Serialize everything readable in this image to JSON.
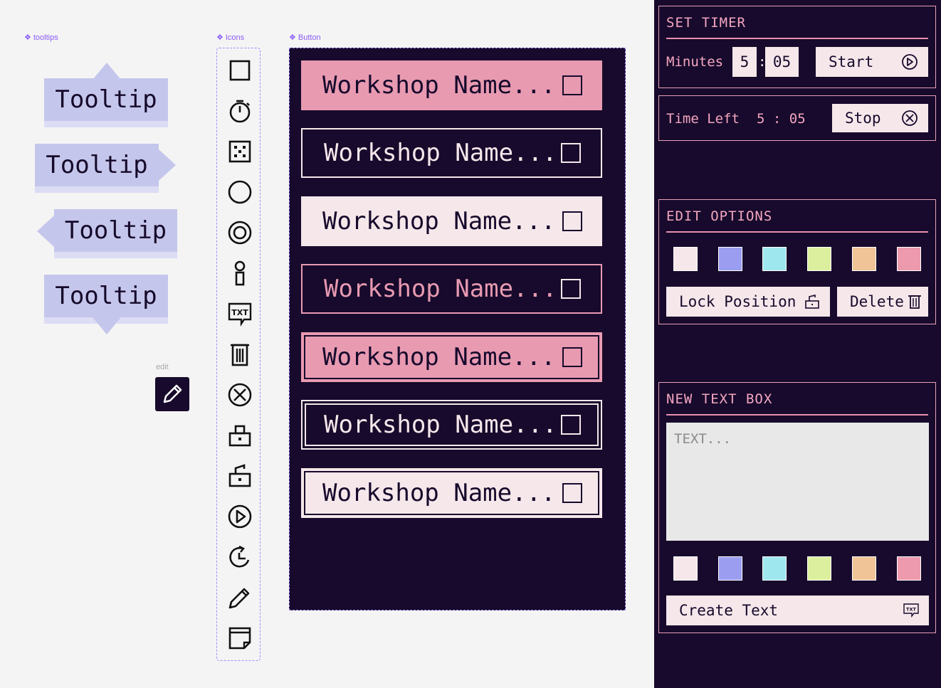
{
  "frames": {
    "tooltips_label": "tooltips",
    "icons_label": "Icons",
    "button_label": "Button",
    "edit_label": "edit"
  },
  "tooltips": [
    "Tooltip",
    "Tooltip",
    "Tooltip",
    "Tooltip"
  ],
  "icons": [
    "square-icon",
    "timer-icon",
    "dice-icon",
    "circle-icon",
    "target-icon",
    "person-icon",
    "txt-icon",
    "trash-icon",
    "close-circle-icon",
    "lock-icon",
    "unlock-icon",
    "play-icon",
    "restart-icon",
    "pencil-icon",
    "note-icon"
  ],
  "workshop_buttons": [
    "Workshop Name...",
    "Workshop Name...",
    "Workshop Name...",
    "Workshop Name...",
    "Workshop Name...",
    "Workshop Name...",
    "Workshop Name..."
  ],
  "set_timer": {
    "title": "SET TIMER",
    "minutes_label": "Minutes",
    "minutes_value": "5",
    "colon": ":",
    "seconds_value": "05",
    "start_label": "Start"
  },
  "time_left": {
    "label": "Time Left",
    "value": "5 : 05",
    "stop_label": "Stop"
  },
  "edit_options": {
    "title": "EDIT OPTIONS",
    "lock_label": "Lock Position",
    "delete_label": "Delete"
  },
  "new_text_box": {
    "title": "NEW TEXT BOX",
    "placeholder": "TEXT...",
    "create_label": "Create Text"
  },
  "swatch_colors": [
    "#f6e7ea",
    "#9b9ef0",
    "#9fe7ef",
    "#dcef9e",
    "#f0c497",
    "#ee9aae"
  ],
  "colors": {
    "dark": "#170a2c",
    "tooltip": "#c5c6ec",
    "pink": "#e89ab1",
    "pale": "#f6e7ea",
    "accent": "#f4a6c0"
  }
}
